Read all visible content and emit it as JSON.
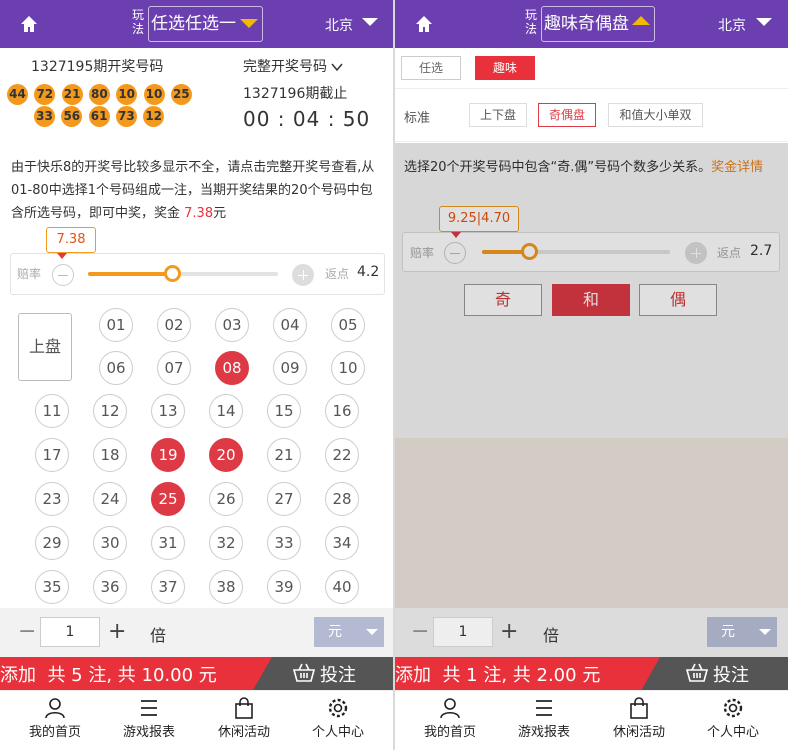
{
  "left": {
    "header": {
      "play_label": "玩法",
      "play_select": "任选任选一",
      "city": "北京"
    },
    "draw": {
      "period_label": "1327195期开奖号码",
      "balls_row1": [
        "44",
        "72",
        "21",
        "80",
        "10",
        "10",
        "25"
      ],
      "balls_row2": [
        "33",
        "56",
        "61",
        "73",
        "12"
      ],
      "full_link": "完整开奖号码",
      "next_period": "1327196期截止",
      "countdown": "00 : 04 : 50"
    },
    "desc": {
      "text": "由于快乐8的开奖号比较多显示不全，请点击完整开奖号查看,从01-80中选择1个号码组成一注，当期开奖结果的20个号码中包含所选号码，即可中奖，奖金 ",
      "prize": "7.38",
      "suffix": "元"
    },
    "slider": {
      "tip": "7.38",
      "odds_label": "赔率",
      "rebate_label": "返点",
      "rebate_value": "4.2",
      "level": 0.44
    },
    "pick": {
      "side_button": "上盘",
      "numbers": [
        "01",
        "02",
        "03",
        "04",
        "05",
        "06",
        "07",
        "08",
        "09",
        "10",
        "11",
        "12",
        "13",
        "14",
        "15",
        "16",
        "17",
        "18",
        "19",
        "20",
        "21",
        "22",
        "23",
        "24",
        "25",
        "26",
        "27",
        "28",
        "29",
        "30",
        "31",
        "32",
        "33",
        "34",
        "35",
        "36",
        "37",
        "38",
        "39",
        "40"
      ],
      "selected": [
        "08",
        "19",
        "20",
        "25"
      ]
    },
    "stepper": {
      "minus": "−",
      "value": "1",
      "plus": "+",
      "multiplier_label": "倍",
      "unit": "元"
    },
    "bet": {
      "add_label": "添加",
      "summary": "共 5 注, 共 10.00 元",
      "bet_label": "投注"
    }
  },
  "right": {
    "header": {
      "play_label": "玩法",
      "play_select": "趣味奇偶盘",
      "city": "北京"
    },
    "tabs": [
      "任选",
      "趣味"
    ],
    "subtype_label": "标准",
    "chips": [
      "上下盘",
      "奇偶盘",
      "和值大小单双"
    ],
    "desc": {
      "text": "选择20个开奖号码中包含“奇.偶”号码个数多少关系。",
      "link": "奖金详情"
    },
    "slider": {
      "tip": "9.25|4.70",
      "odds_label": "赔率",
      "rebate_label": "返点",
      "rebate_value": "2.7",
      "level": 0.25
    },
    "options": [
      "奇",
      "和",
      "偶"
    ],
    "stepper": {
      "minus": "−",
      "value": "1",
      "plus": "+",
      "multiplier_label": "倍",
      "unit": "元"
    },
    "bet": {
      "add_label": "添加",
      "summary": "共 1 注, 共 2.00 元",
      "bet_label": "投注"
    }
  },
  "footer": {
    "items": [
      "我的首页",
      "游戏报表",
      "休闲活动",
      "个人中心"
    ]
  },
  "colors": {
    "header": "#6b3fb0",
    "accent_red": "#dd3a45",
    "ball_orange": "#f39a1e"
  }
}
